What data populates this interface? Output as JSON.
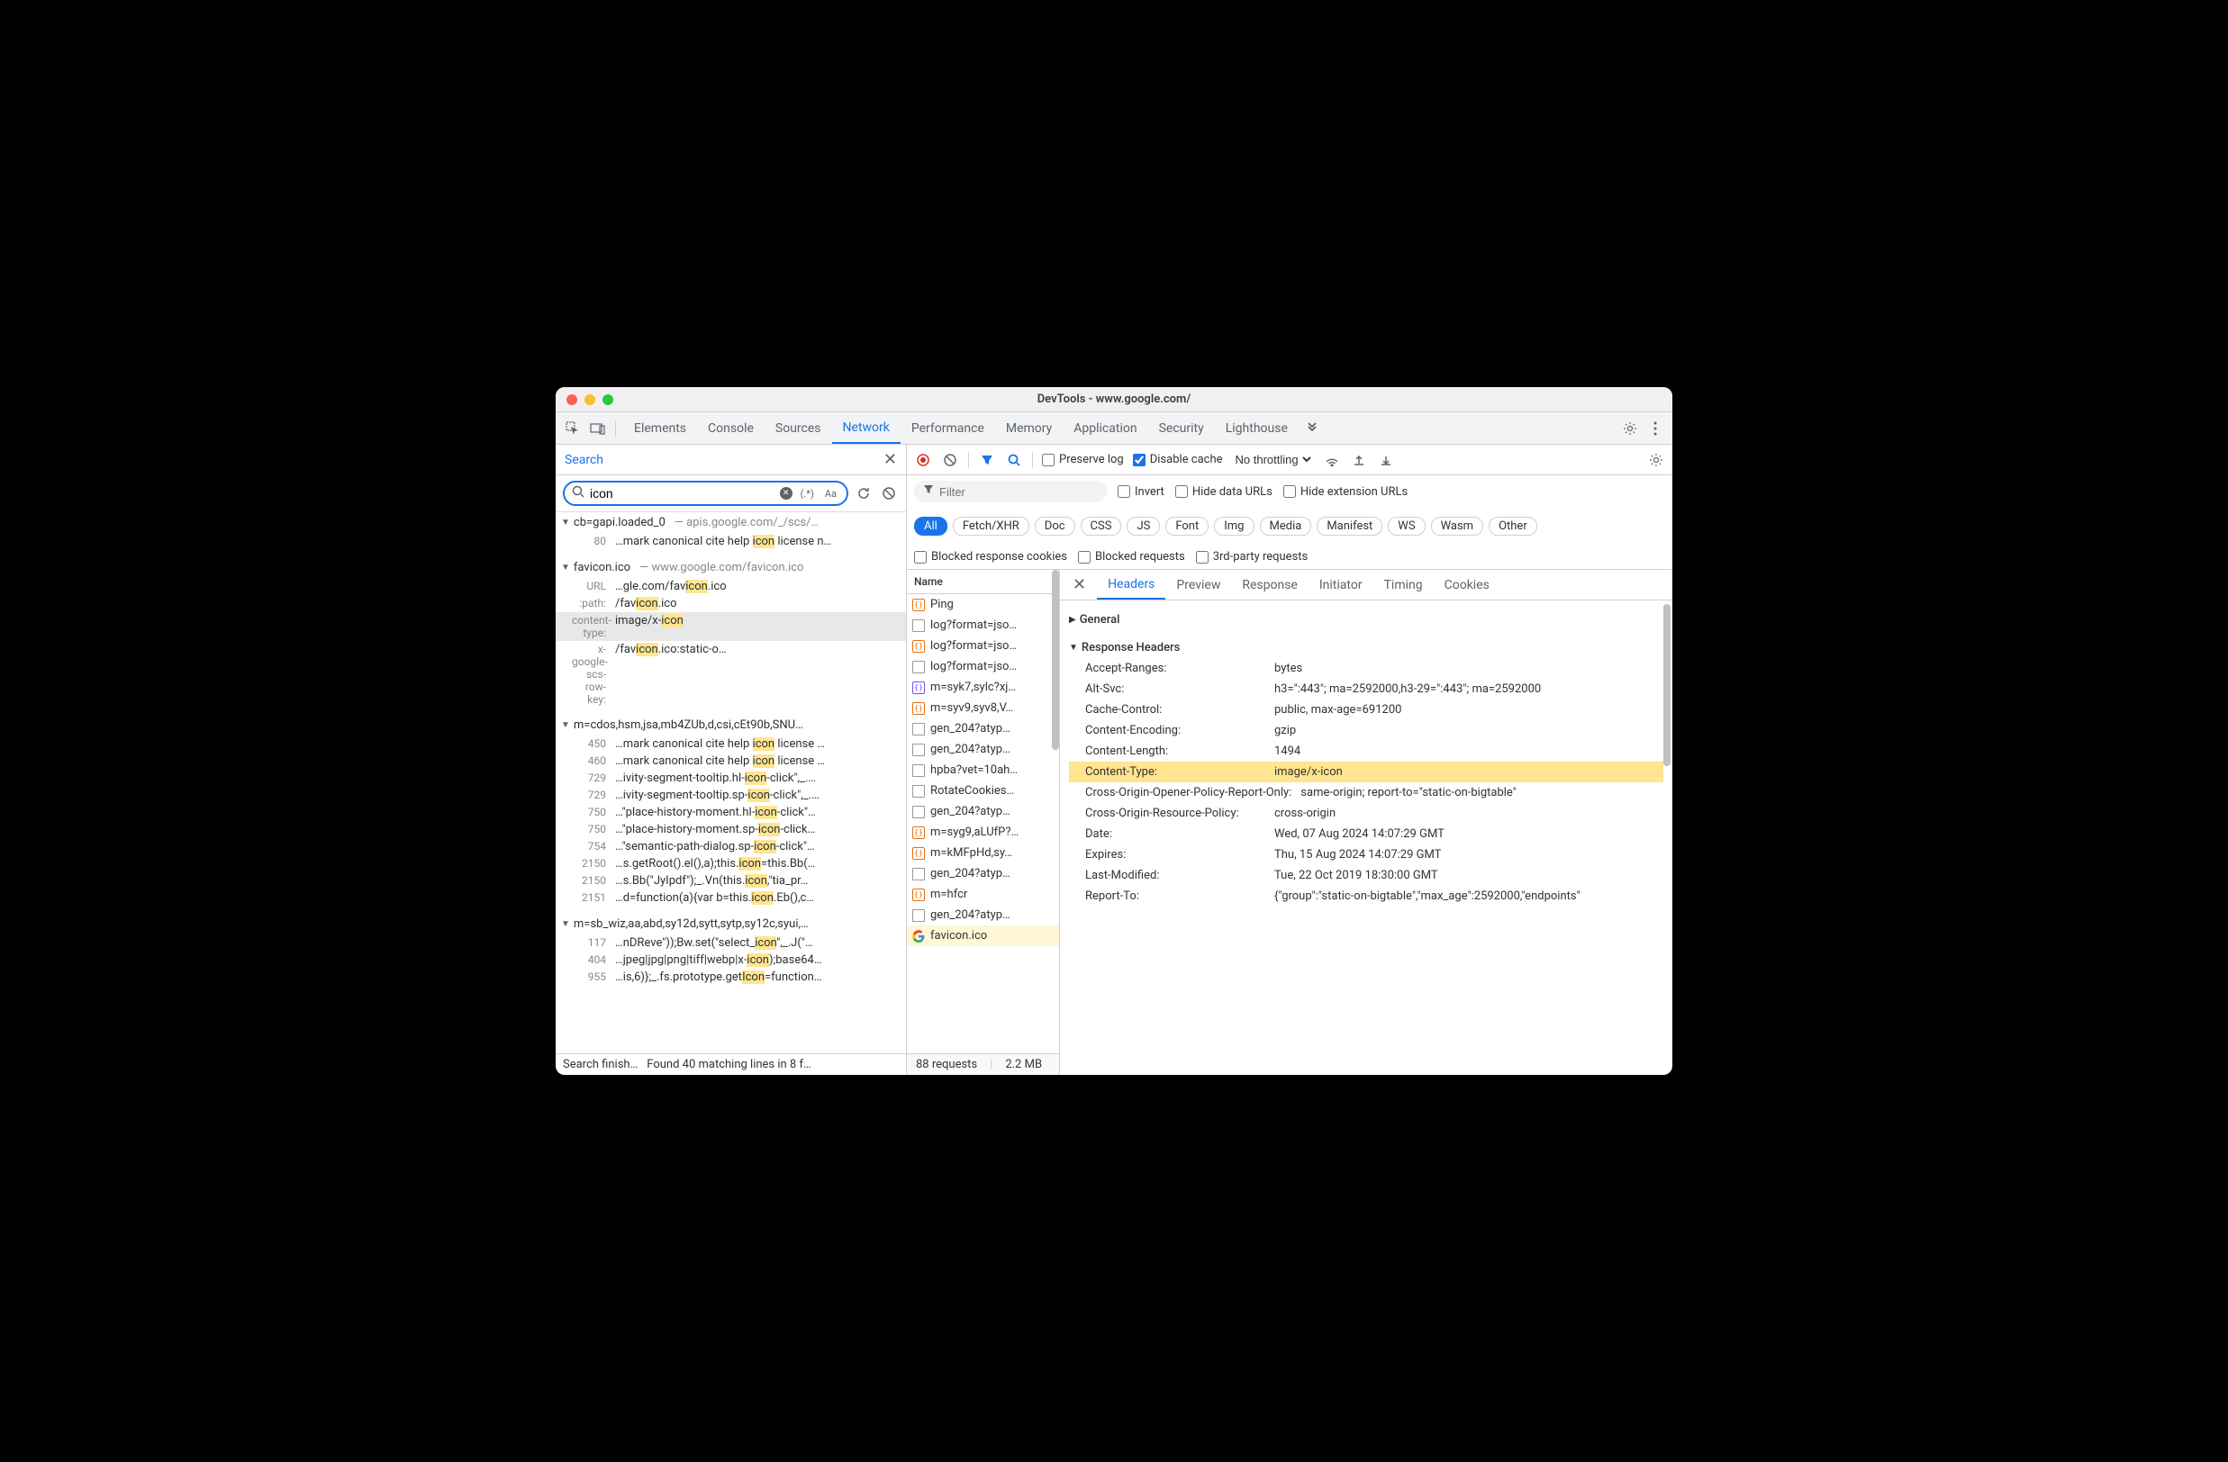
{
  "window_title": "DevTools - www.google.com/",
  "main_tabs": [
    "Elements",
    "Console",
    "Sources",
    "Network",
    "Performance",
    "Memory",
    "Application",
    "Security",
    "Lighthouse"
  ],
  "main_active_tab": "Network",
  "search": {
    "label": "Search",
    "query": "icon",
    "regex": "(.*)",
    "case": "Aa",
    "status_a": "Search finish…",
    "status_b": "Found 40 matching lines in 8 f…"
  },
  "search_results": [
    {
      "name": "cb=gapi.loaded_0",
      "path": "apis.google.com/_/scs/…",
      "lines": [
        {
          "n": "80",
          "t": "…mark canonical cite help icon license n…"
        }
      ]
    },
    {
      "name": "favicon.ico",
      "path": "www.google.com/favicon.ico",
      "lines": [
        {
          "n": "URL",
          "t": "…gle.com/favicon.ico"
        },
        {
          "n": ":path:",
          "t": "/favicon.ico"
        },
        {
          "n": "content-type:",
          "t": "image/x-icon",
          "sel": true
        },
        {
          "n": "x-google-scs-row-key:",
          "t": "/favicon.ico:static-o…"
        }
      ]
    },
    {
      "name": "m=cdos,hsm,jsa,mb4ZUb,d,csi,cEt90b,SNU…",
      "path": "",
      "lines": [
        {
          "n": "450",
          "t": "…mark canonical cite help icon license …"
        },
        {
          "n": "460",
          "t": "…mark canonical cite help icon license …"
        },
        {
          "n": "729",
          "t": "…ivity-segment-tooltip.hl-icon-click\",_.…"
        },
        {
          "n": "729",
          "t": "…ivity-segment-tooltip.sp-icon-click\",_.…"
        },
        {
          "n": "750",
          "t": "…\"place-history-moment.hl-icon-click\"…"
        },
        {
          "n": "750",
          "t": "…\"place-history-moment.sp-icon-click…"
        },
        {
          "n": "754",
          "t": "…\"semantic-path-dialog.sp-icon-click\"…"
        },
        {
          "n": "2150",
          "t": "…s.getRoot().el(),a);this.icon=this.Bb(…"
        },
        {
          "n": "2150",
          "t": "…s.Bb(\"JyIpdf\");_.Vn(this.icon,\"tia_pr…"
        },
        {
          "n": "2151",
          "t": "…d=function(a){var b=this.icon.Eb(),c…"
        }
      ]
    },
    {
      "name": "m=sb_wiz,aa,abd,sy12d,sytt,sytp,sy12c,syui,…",
      "path": "",
      "lines": [
        {
          "n": "117",
          "t": "…nDReve\"));Bw.set(\"select_icon\",_.J(\"…"
        },
        {
          "n": "404",
          "t": "…jpeg|jpg|png|tiff|webp|x-icon);base64…"
        },
        {
          "n": "955",
          "t": "…is,6)};_.fs.prototype.getIcon=function…"
        }
      ]
    }
  ],
  "toolbar": {
    "preserve_log": "Preserve log",
    "disable_cache": "Disable cache",
    "throttling": "No throttling"
  },
  "filter": {
    "placeholder": "Filter",
    "invert": "Invert",
    "hide_data": "Hide data URLs",
    "hide_ext": "Hide extension URLs",
    "blocked_cookies": "Blocked response cookies",
    "blocked_req": "Blocked requests",
    "third_party": "3rd-party requests"
  },
  "filter_chips": [
    "All",
    "Fetch/XHR",
    "Doc",
    "CSS",
    "JS",
    "Font",
    "Img",
    "Media",
    "Manifest",
    "WS",
    "Wasm",
    "Other"
  ],
  "reqlist_header": "Name",
  "requests": [
    {
      "name": "Ping",
      "icon": "json"
    },
    {
      "name": "log?format=jso…",
      "icon": "doc"
    },
    {
      "name": "log?format=jso…",
      "icon": "json"
    },
    {
      "name": "log?format=jso…",
      "icon": "doc"
    },
    {
      "name": "m=syk7,sylc?xj…",
      "icon": "jsonblue"
    },
    {
      "name": "m=syv9,syv8,V…",
      "icon": "json"
    },
    {
      "name": "gen_204?atyp…",
      "icon": "doc"
    },
    {
      "name": "gen_204?atyp…",
      "icon": "doc"
    },
    {
      "name": "hpba?vet=10ah…",
      "icon": "doc"
    },
    {
      "name": "RotateCookies…",
      "icon": "doc"
    },
    {
      "name": "gen_204?atyp…",
      "icon": "doc"
    },
    {
      "name": "m=syg9,aLUfP?…",
      "icon": "json"
    },
    {
      "name": "m=kMFpHd,sy…",
      "icon": "json"
    },
    {
      "name": "gen_204?atyp…",
      "icon": "doc"
    },
    {
      "name": "m=hfcr",
      "icon": "json"
    },
    {
      "name": "gen_204?atyp…",
      "icon": "doc"
    },
    {
      "name": "favicon.ico",
      "icon": "google",
      "sel": true
    }
  ],
  "status_bar": {
    "count": "88 requests",
    "size": "2.2 MB"
  },
  "detail_tabs": [
    "Headers",
    "Preview",
    "Response",
    "Initiator",
    "Timing",
    "Cookies"
  ],
  "detail_active": "Headers",
  "sections": {
    "general": "General",
    "response_headers": "Response Headers"
  },
  "headers": [
    {
      "k": "Accept-Ranges:",
      "v": "bytes"
    },
    {
      "k": "Alt-Svc:",
      "v": "h3=\":443\"; ma=2592000,h3-29=\":443\"; ma=2592000"
    },
    {
      "k": "Cache-Control:",
      "v": "public, max-age=691200"
    },
    {
      "k": "Content-Encoding:",
      "v": "gzip"
    },
    {
      "k": "Content-Length:",
      "v": "1494"
    },
    {
      "k": "Content-Type:",
      "v": "image/x-icon",
      "hl": true
    },
    {
      "k": "Cross-Origin-Opener-Policy-Report-Only:",
      "v": "same-origin; report-to=\"static-on-bigtable\""
    },
    {
      "k": "Cross-Origin-Resource-Policy:",
      "v": "cross-origin"
    },
    {
      "k": "Date:",
      "v": "Wed, 07 Aug 2024 14:07:29 GMT"
    },
    {
      "k": "Expires:",
      "v": "Thu, 15 Aug 2024 14:07:29 GMT"
    },
    {
      "k": "Last-Modified:",
      "v": "Tue, 22 Oct 2019 18:30:00 GMT"
    },
    {
      "k": "Report-To:",
      "v": "{\"group\":\"static-on-bigtable\",\"max_age\":2592000,\"endpoints\""
    }
  ]
}
